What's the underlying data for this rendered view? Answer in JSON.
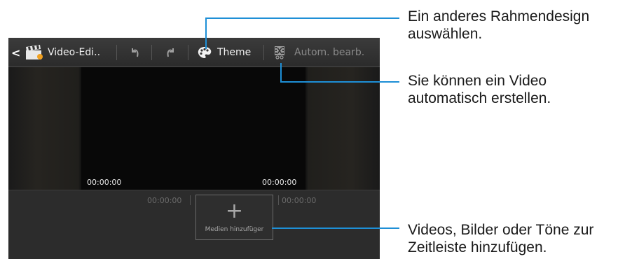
{
  "toolbar": {
    "back_icon": "chevron-left-icon",
    "app_icon": "clapperboard-icon",
    "title": "Video-Edi..",
    "undo_icon": "undo-icon",
    "redo_icon": "redo-icon",
    "theme_icon": "palette-icon",
    "theme_label": "Theme",
    "auto_icon": "film-auto-icon",
    "auto_label": "Autom. bearb."
  },
  "preview": {
    "time_start": "00:00:00",
    "time_end": "00:00:00"
  },
  "timeline": {
    "time_left": "00:00:00",
    "time_right": "00:00:00",
    "add_plus": "+",
    "add_label": "Medien hinzufüger"
  },
  "callouts": {
    "theme": [
      "Ein anderes Rahmendesign",
      "auswählen."
    ],
    "auto": [
      "Sie können ein Video",
      "automatisch erstellen."
    ],
    "media": [
      "Videos, Bilder oder Töne zur",
      "Zeitleiste hinzufügen."
    ]
  },
  "colors": {
    "callout_line": "#1e8fd6",
    "actionbar": "#333333",
    "timeline": "#2c2c2c"
  }
}
